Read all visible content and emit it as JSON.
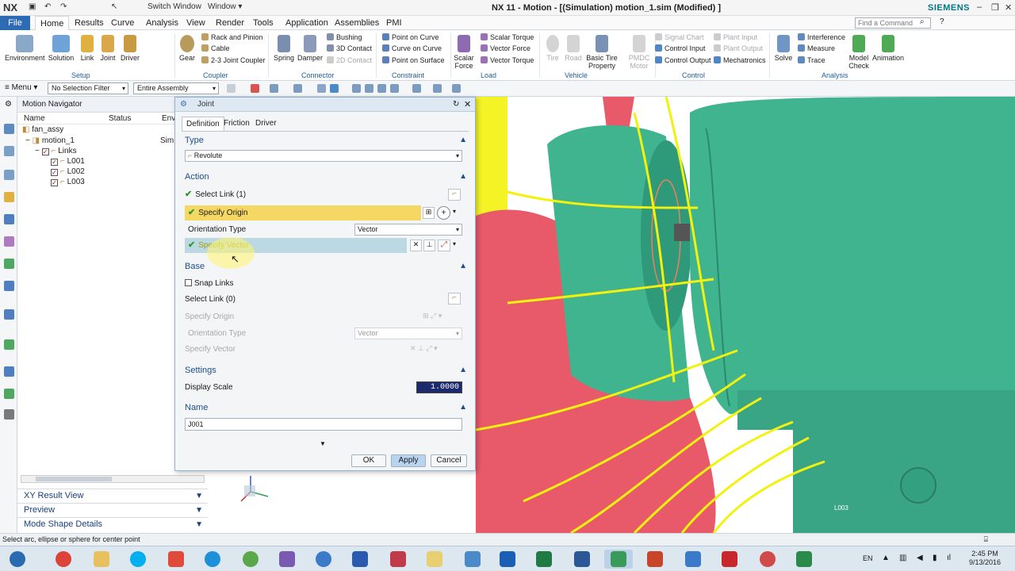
{
  "titlebar": {
    "logo": "NX",
    "switch_window": "Switch Window",
    "window_menu": "Window",
    "title": "NX 11 - Motion - [(Simulation) motion_1.sim (Modified) ]",
    "brand": "SIEMENS"
  },
  "menubar": {
    "file": "File",
    "tabs": [
      "Home",
      "Results",
      "Curve",
      "Analysis",
      "View",
      "Render",
      "Tools",
      "Application",
      "Assemblies",
      "PMI"
    ],
    "search_placeholder": "Find a Command"
  },
  "ribbon": {
    "setup": {
      "label": "Setup",
      "buttons": [
        "Environment",
        "Solution",
        "Link",
        "Joint",
        "Driver"
      ]
    },
    "coupler": {
      "label": "Coupler",
      "gear": "Gear",
      "items": [
        "Rack and Pinion",
        "Cable",
        "2-3 Joint Coupler"
      ]
    },
    "connector": {
      "label": "Connector",
      "buttons": [
        "Spring",
        "Damper"
      ],
      "items": [
        "Bushing",
        "3D Contact",
        "2D Contact"
      ]
    },
    "constraint": {
      "label": "Constraint",
      "items": [
        "Point on Curve",
        "Curve on Curve",
        "Point on Surface"
      ]
    },
    "load": {
      "label": "Load",
      "scalar_force": "Scalar Force",
      "items": [
        "Scalar Torque",
        "Vector Force",
        "Vector Torque"
      ]
    },
    "vehicle": {
      "label": "Vehicle",
      "buttons": [
        "Tire",
        "Road"
      ],
      "basic_tire": "Basic Tire Property",
      "pmdc": "PMDC Motor"
    },
    "control": {
      "label": "Control",
      "items_left": [
        "Signal Chart",
        "Control Input",
        "Control Output"
      ],
      "items_right": [
        "Plant Input",
        "Plant Output",
        "Mechatronics"
      ]
    },
    "analysis": {
      "label": "Analysis",
      "solve": "Solve",
      "items": [
        "Interference",
        "Measure",
        "Trace"
      ],
      "model_check": "Model Check",
      "animation": "Animation"
    }
  },
  "selbar": {
    "menu": "Menu",
    "filter": "No Selection Filter",
    "scope": "Entire Assembly"
  },
  "navigator": {
    "title": "Motion Navigator",
    "col_name": "Name",
    "col_status": "Status",
    "col_env": "Env",
    "tree": [
      {
        "label": "fan_assy",
        "extra": ""
      },
      {
        "label": "motion_1",
        "extra": "Sim"
      },
      {
        "label": "Links",
        "extra": ""
      },
      {
        "label": "L001",
        "extra": ""
      },
      {
        "label": "L002",
        "extra": ""
      },
      {
        "label": "L003",
        "extra": ""
      }
    ],
    "sections": [
      "XY Result View",
      "Preview",
      "Mode Shape Details"
    ]
  },
  "dialog": {
    "title": "Joint",
    "tabs": [
      "Definition",
      "Friction",
      "Driver"
    ],
    "type_group": "Type",
    "type_value": "Revolute",
    "action_group": "Action",
    "select_link": "Select Link (1)",
    "specify_origin": "Specify Origin",
    "orientation_type": "Orientation Type",
    "orientation_value": "Vector",
    "specify_vector": "Specify Vector",
    "base_group": "Base",
    "snap_links": "Snap Links",
    "base_select_link": "Select Link (0)",
    "base_specify_origin": "Specify Origin",
    "base_orientation_type": "Orientation Type",
    "base_orientation_value": "Vector",
    "base_specify_vector": "Specify Vector",
    "settings_group": "Settings",
    "display_scale_label": "Display Scale",
    "display_scale_value": "1.0000",
    "name_group": "Name",
    "name_value": "J001",
    "ok": "OK",
    "apply": "Apply",
    "cancel": "Cancel"
  },
  "viewport": {
    "link_label": "L003"
  },
  "statusbar": {
    "message": "Select arc, ellipse or sphere for center point"
  },
  "taskbar": {
    "lang": "EN",
    "time": "2:45 PM",
    "date": "9/13/2016"
  },
  "colors": {
    "accent": "#2d6bb5",
    "origin_highlight": "#f5d764",
    "vector_highlight": "#bcd8e2",
    "model_green": "#3fb48f",
    "model_red": "#e85a6a",
    "wire_yellow": "#f2f20e"
  }
}
